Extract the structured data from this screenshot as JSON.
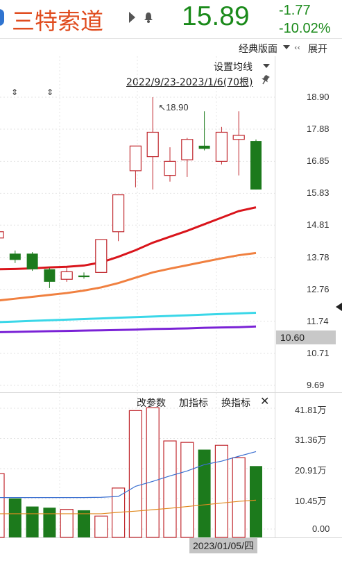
{
  "header": {
    "stock_name": "三特索道",
    "price": "15.89",
    "change": "-1.77",
    "change_pct": "-10.02%"
  },
  "toolbar": {
    "classic_layout_label": "经典版面",
    "expand_label": "展开",
    "set_ma_label": "设置均线",
    "date_range": "2022/9/23-2023/1/6(70根)"
  },
  "price_panel": {
    "high_annotation": "↖18.90",
    "y_ticks": [
      "18.90",
      "17.88",
      "16.85",
      "15.83",
      "14.81",
      "13.78",
      "12.76",
      "11.74",
      "10.71",
      "9.69"
    ],
    "crosshair_price": "10.60"
  },
  "volume_panel": {
    "menu": [
      "改参数",
      "加指标",
      "换指标"
    ],
    "y_ticks": [
      "41.81万",
      "31.36万",
      "20.91万",
      "10.45万",
      "0.00"
    ],
    "date_label": "2023/01/05/四"
  },
  "colors": {
    "up": "#c0272d",
    "down": "#1c7a1c",
    "ma5": "#d9141b",
    "ma10": "#f08040",
    "ma20": "#3ad7e8",
    "ma30": "#7a22d6"
  },
  "chart_data": {
    "type": "candlestick",
    "ylim": [
      9.69,
      18.9
    ],
    "candles": [
      {
        "o": 14.4,
        "c": 14.6,
        "h": 14.6,
        "l": 14.4
      },
      {
        "o": 13.9,
        "c": 13.7,
        "h": 14.0,
        "l": 13.6
      },
      {
        "o": 13.9,
        "c": 13.4,
        "h": 13.95,
        "l": 13.35
      },
      {
        "o": 13.4,
        "c": 13.0,
        "h": 13.45,
        "l": 12.8
      },
      {
        "o": 13.08,
        "c": 13.32,
        "h": 13.5,
        "l": 13.0
      },
      {
        "o": 13.2,
        "c": 13.15,
        "h": 13.3,
        "l": 13.1
      },
      {
        "o": 13.3,
        "c": 14.35,
        "h": 14.35,
        "l": 13.3
      },
      {
        "o": 14.6,
        "c": 15.78,
        "h": 15.78,
        "l": 14.3
      },
      {
        "o": 16.55,
        "c": 17.34,
        "h": 17.34,
        "l": 16.02
      },
      {
        "o": 17.0,
        "c": 17.78,
        "h": 18.9,
        "l": 15.95
      },
      {
        "o": 16.4,
        "c": 16.85,
        "h": 17.3,
        "l": 16.2
      },
      {
        "o": 16.9,
        "c": 17.55,
        "h": 17.6,
        "l": 16.35
      },
      {
        "o": 17.35,
        "c": 17.25,
        "h": 18.45,
        "l": 17.2
      },
      {
        "o": 16.85,
        "c": 17.78,
        "h": 17.95,
        "l": 16.75
      },
      {
        "o": 17.55,
        "c": 17.68,
        "h": 18.45,
        "l": 16.4
      },
      {
        "o": 17.5,
        "c": 15.95,
        "h": 17.55,
        "l": 15.95
      }
    ],
    "ma5": [
      13.4,
      13.41,
      13.43,
      13.46,
      13.48,
      13.52,
      13.62,
      13.8,
      14.01,
      14.25,
      14.44,
      14.63,
      14.84,
      15.05,
      15.26,
      15.38
    ],
    "ma10": [
      12.4,
      12.46,
      12.52,
      12.58,
      12.64,
      12.72,
      12.82,
      12.96,
      13.13,
      13.3,
      13.42,
      13.53,
      13.64,
      13.75,
      13.85,
      13.92
    ],
    "ma20": [
      11.71,
      11.73,
      11.75,
      11.77,
      11.79,
      11.81,
      11.83,
      11.85,
      11.87,
      11.89,
      11.91,
      11.93,
      11.95,
      11.97,
      11.99,
      12.01
    ],
    "ma30": [
      11.39,
      11.4,
      11.41,
      11.42,
      11.43,
      11.44,
      11.45,
      11.46,
      11.47,
      11.49,
      11.5,
      11.51,
      11.53,
      11.54,
      11.55,
      11.57
    ],
    "volume": {
      "ylim": [
        0,
        41.81
      ],
      "unit": "万",
      "values": [
        19.2,
        10.6,
        7.8,
        7.4,
        6.8,
        6.5,
        4.5,
        14.2,
        41.0,
        42.0,
        30.5,
        30.0,
        27.5,
        29.0,
        24.7,
        21.8
      ],
      "ma_blue": [
        10.9,
        10.9,
        10.9,
        10.9,
        10.9,
        10.9,
        11.0,
        11.3,
        14.8,
        16.5,
        18.4,
        20.1,
        22.3,
        23.5,
        25.2,
        26.8
      ],
      "ma_orange": [
        5.3,
        5.3,
        5.3,
        5.3,
        5.3,
        5.3,
        5.3,
        5.8,
        6.2,
        6.7,
        7.2,
        7.8,
        8.4,
        9.0,
        9.6,
        10.0
      ]
    }
  }
}
